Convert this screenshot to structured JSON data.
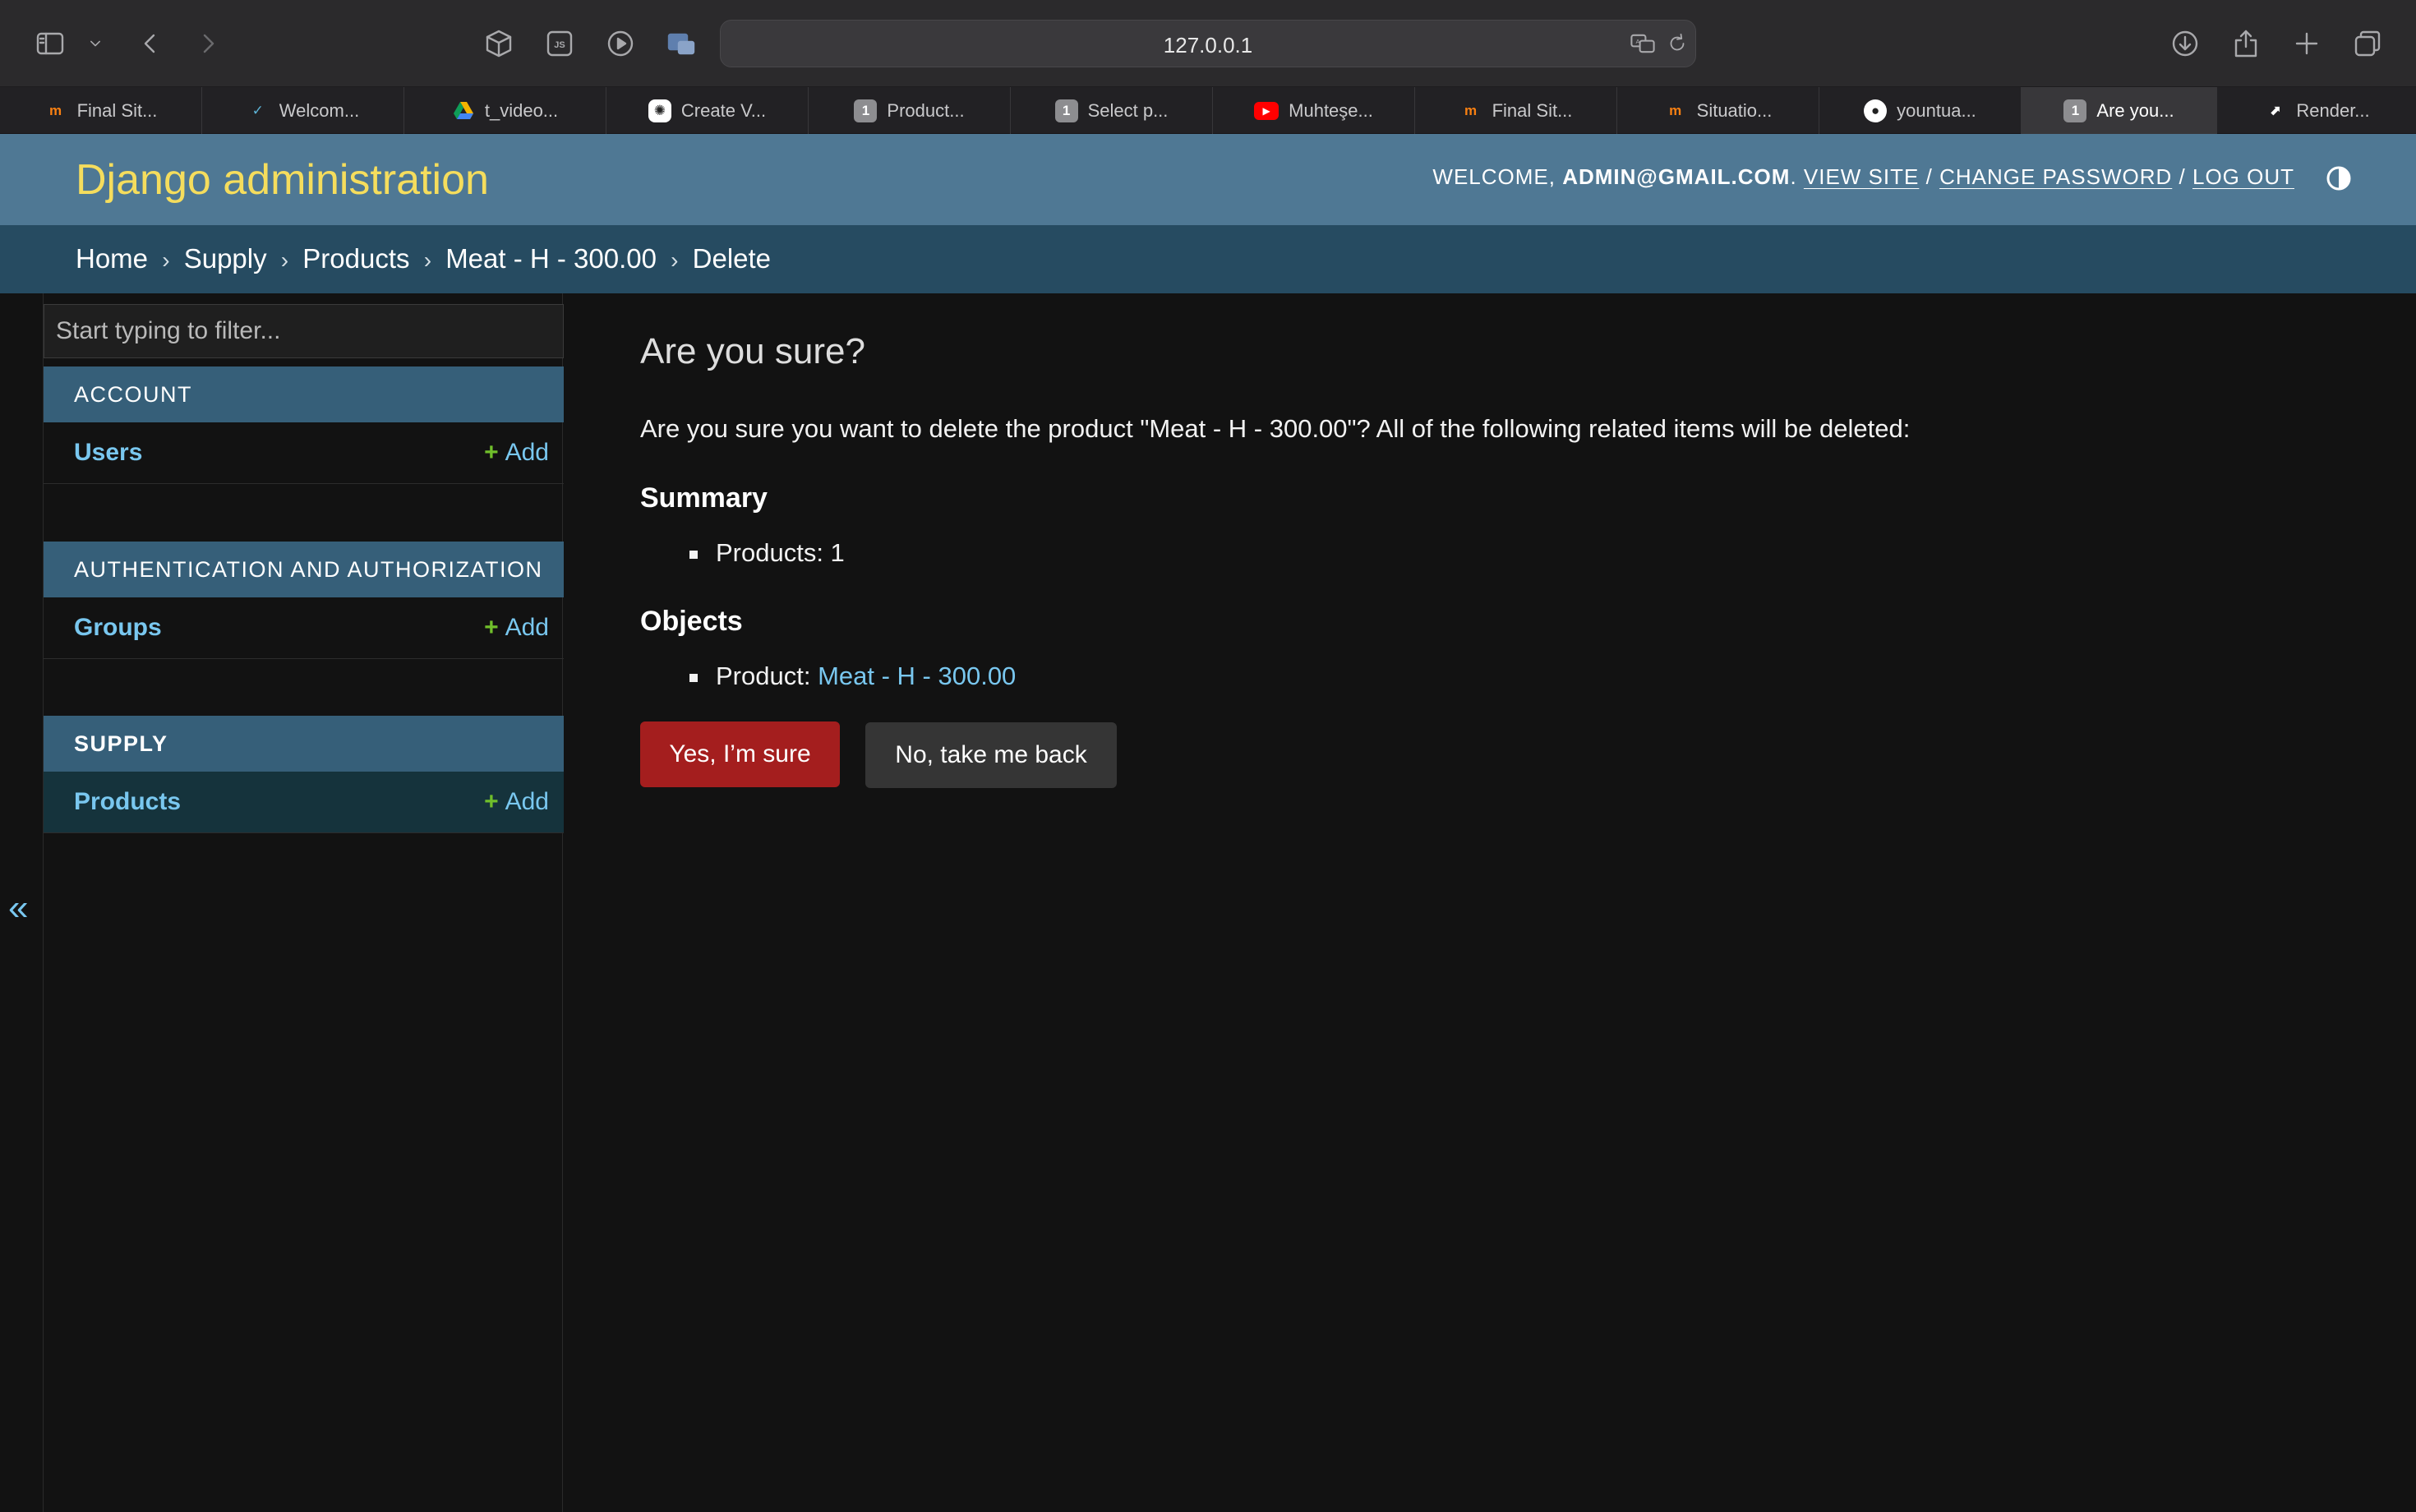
{
  "browser": {
    "url": "127.0.0.1",
    "tabs": [
      {
        "title": "Final Sit...",
        "favicon": "moodle-icon"
      },
      {
        "title": "Welcom...",
        "favicon": "bird-icon"
      },
      {
        "title": "t_video...",
        "favicon": "google-drive-icon"
      },
      {
        "title": "Create V...",
        "favicon": "openai-icon"
      },
      {
        "title": "Product...",
        "favicon": "number-one-icon"
      },
      {
        "title": "Select p...",
        "favicon": "number-one-icon"
      },
      {
        "title": "Muhteşe...",
        "favicon": "youtube-icon"
      },
      {
        "title": "Final Sit...",
        "favicon": "moodle-icon"
      },
      {
        "title": "Situatio...",
        "favicon": "moodle-icon"
      },
      {
        "title": "yountua...",
        "favicon": "github-icon"
      },
      {
        "title": "Are you...",
        "favicon": "number-one-icon",
        "active": true
      },
      {
        "title": "Render...",
        "favicon": "render-icon"
      }
    ]
  },
  "header": {
    "branding": "Django administration",
    "welcome": "WELCOME,",
    "user": "ADMIN@GMAIL.COM",
    "view_site": "VIEW SITE",
    "change_password": "CHANGE PASSWORD",
    "log_out": "LOG OUT",
    "sep": "/"
  },
  "breadcrumbs": {
    "home": "Home",
    "app": "Supply",
    "model": "Products",
    "object": "Meat - H - 300.00",
    "current": "Delete",
    "sep": "›"
  },
  "sidebar": {
    "filter_placeholder": "Start typing to filter...",
    "add_label": "Add",
    "modules": [
      {
        "caption": "ACCOUNT",
        "model": "Users"
      },
      {
        "caption": "AUTHENTICATION AND AUTHORIZATION",
        "model": "Groups"
      },
      {
        "caption": "SUPPLY",
        "model": "Products",
        "current": true
      }
    ],
    "collapse": "«"
  },
  "content": {
    "title": "Are you sure?",
    "message": "Are you sure you want to delete the product \"Meat - H - 300.00\"? All of the following related items will be deleted:",
    "summary_title": "Summary",
    "summary_item": "Products: 1",
    "objects_title": "Objects",
    "object_label": "Product:",
    "object_link": "Meat - H - 300.00",
    "confirm_button": "Yes, I’m sure",
    "cancel_button": "No, take me back"
  },
  "colors": {
    "header_bg": "#4f7894",
    "branding": "#f5dd5d",
    "breadcrumbs_bg": "#264b61",
    "module_caption_bg": "#365f79",
    "link": "#79c7ef",
    "danger": "#a41e1e",
    "add_plus": "#70bf2b"
  }
}
